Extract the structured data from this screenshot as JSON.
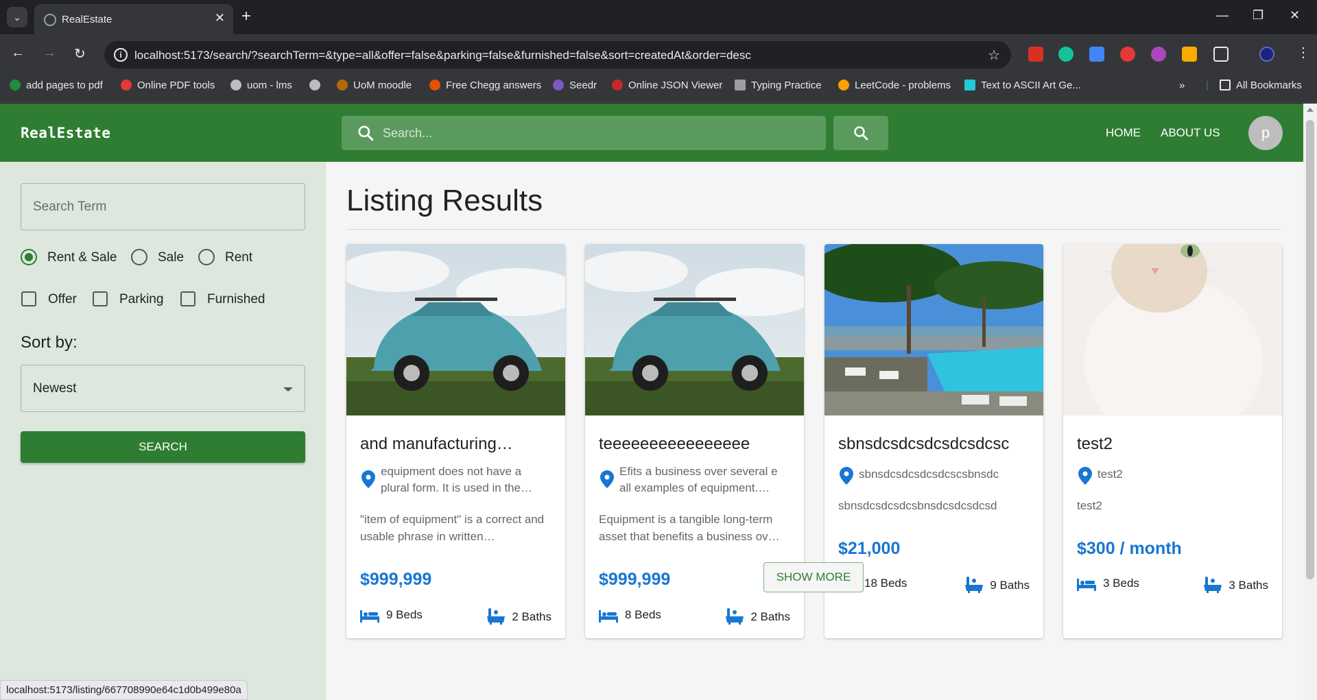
{
  "browser": {
    "tab_title": "RealEstate",
    "url": "localhost:5173/search/?searchTerm=&type=all&offer=false&parking=false&furnished=false&sort=createdAt&order=desc",
    "bookmarks": [
      "add pages to pdf",
      "Online PDF tools",
      "uom - lms",
      "",
      "UoM moodle",
      "Free Chegg answers",
      "Seedr",
      "Online JSON Viewer",
      "Typing Practice",
      "LeetCode - problems",
      "Text to ASCII Art Ge..."
    ],
    "all_bookmarks": "All Bookmarks",
    "status_url": "localhost:5173/listing/667708990e64c1d0b499e80a"
  },
  "header": {
    "brand": "RealEstate",
    "search_placeholder": "Search...",
    "nav": [
      "HOME",
      "ABOUT US"
    ],
    "avatar_initial": "p"
  },
  "sidebar": {
    "search_term_placeholder": "Search Term",
    "type_options": [
      {
        "label": "Rent & Sale",
        "checked": true
      },
      {
        "label": "Sale",
        "checked": false
      },
      {
        "label": "Rent",
        "checked": false
      }
    ],
    "amenities": [
      {
        "label": "Offer",
        "checked": false
      },
      {
        "label": "Parking",
        "checked": false
      },
      {
        "label": "Furnished",
        "checked": false
      }
    ],
    "sort_label": "Sort by:",
    "sort_value": "Newest",
    "search_button": "SEARCH"
  },
  "main": {
    "heading": "Listing Results",
    "show_more": "SHOW MORE",
    "listings": [
      {
        "image": "blue-car-on-grass",
        "title": "and manufacturing…",
        "address": "equipment does not have a plural form. It is used in the…",
        "description": "\"item of equipment\" is a correct and usable phrase in written…",
        "price": "$999,999",
        "beds": "9 Beds",
        "baths": "2 Baths"
      },
      {
        "image": "blue-car-on-grass",
        "title": "teeeeeeeeeeeeeeee",
        "address": "Efits a business over several e all examples of equipment.…",
        "description": "Equipment is a tangible long-term asset that benefits a business ov…",
        "price": "$999,999",
        "beds": "8 Beds",
        "baths": "2 Baths"
      },
      {
        "image": "resort-pool-by-sea",
        "title": "sbnsdcsdcsdcsdcsdcsc",
        "address": "sbnsdcsdcsdcsdcscsbnsdc",
        "description": "sbnsdcsdcsdcsbnsdcsdcsdcsd",
        "price": "$21,000",
        "beds": "18 Beds",
        "baths": "9 Baths"
      },
      {
        "image": "white-kitten",
        "title": "test2",
        "address": "test2",
        "description": "test2",
        "price": "$300 / month",
        "beds": "3 Beds",
        "baths": "3 Baths"
      }
    ]
  },
  "colors": {
    "brand_green": "#2e7d32",
    "price_blue": "#1976d2"
  }
}
